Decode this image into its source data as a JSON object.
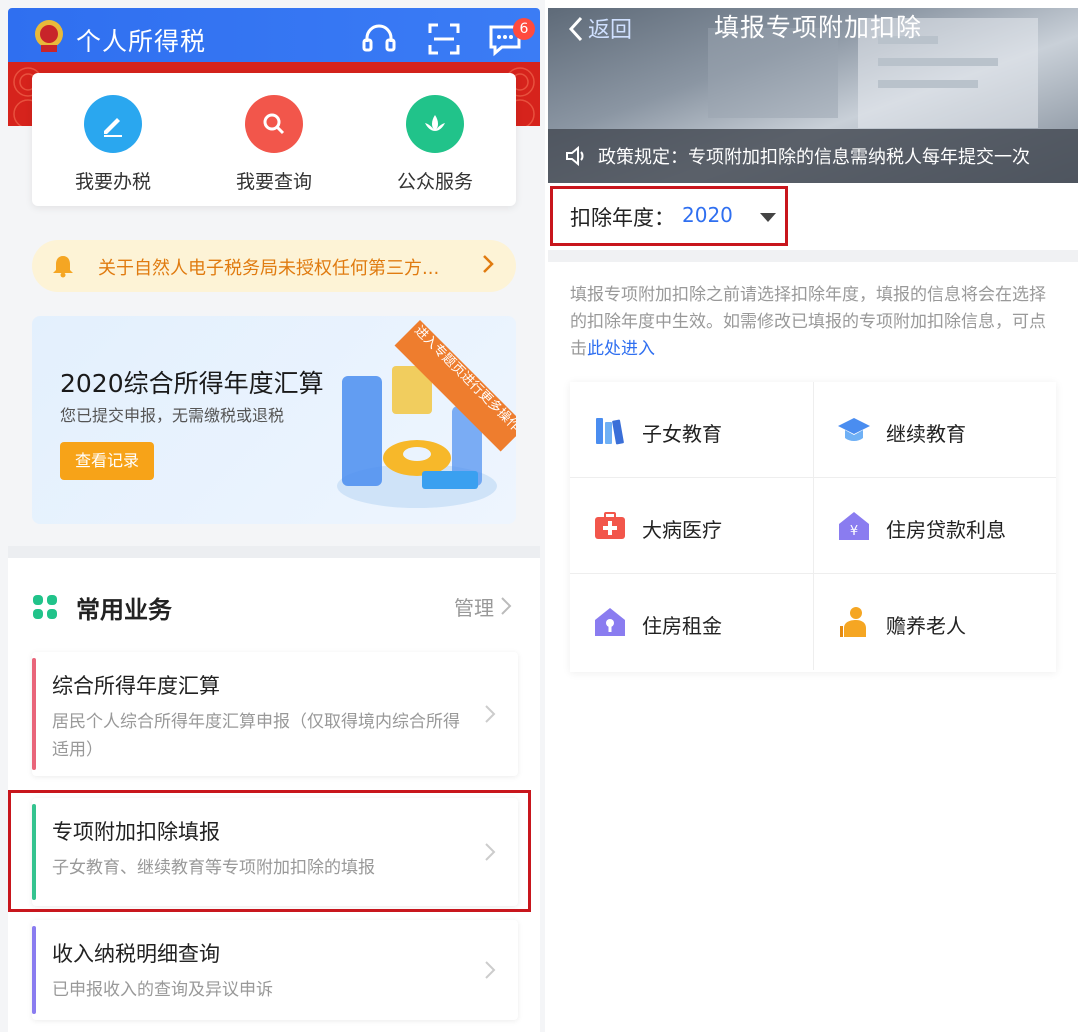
{
  "left": {
    "app_title": "个人所得税",
    "notification_count": "6",
    "services": [
      {
        "label": "我要办税",
        "icon": "pen-icon",
        "color": "#2aa7ef"
      },
      {
        "label": "我要查询",
        "icon": "search-icon",
        "color": "#f2564b"
      },
      {
        "label": "公众服务",
        "icon": "lotus-icon",
        "color": "#21c38a"
      }
    ],
    "notice": "关于自然人电子税务局未授权任何第三方...",
    "banner": {
      "title": "2020综合所得年度汇算",
      "subtitle": "您已提交申报，无需缴税或退税",
      "button": "查看记录",
      "ribbon": "进入专题页进行更多操作"
    },
    "common": {
      "title": "常用业务",
      "manage": "管理",
      "items": [
        {
          "title": "综合所得年度汇算",
          "subtitle": "居民个人综合所得年度汇算申报（仅取得境内综合所得适用）",
          "color": "#e9657a"
        },
        {
          "title": "专项附加扣除填报",
          "subtitle": "子女教育、继续教育等专项附加扣除的填报",
          "color": "#34c38f"
        },
        {
          "title": "收入纳税明细查询",
          "subtitle": "已申报收入的查询及异议申诉",
          "color": "#8a7cf0"
        }
      ]
    }
  },
  "right": {
    "back": "返回",
    "title": "填报专项附加扣除",
    "policy": "政策规定：专项附加扣除的信息需纳税人每年提交一次",
    "year_label": "扣除年度：",
    "year_value": "2020",
    "desc_text": "填报专项附加扣除之前请选择扣除年度，填报的信息将会在选择的扣除年度中生效。如需修改已填报的专项附加扣除信息，可点击",
    "desc_link": "此处进入",
    "categories": [
      {
        "label": "子女教育",
        "icon": "books-icon"
      },
      {
        "label": "继续教育",
        "icon": "graduation-cap-icon"
      },
      {
        "label": "大病医疗",
        "icon": "medical-kit-icon"
      },
      {
        "label": "住房贷款利息",
        "icon": "house-yuan-icon"
      },
      {
        "label": "住房租金",
        "icon": "house-key-icon"
      },
      {
        "label": "赡养老人",
        "icon": "elderly-person-icon"
      }
    ]
  }
}
